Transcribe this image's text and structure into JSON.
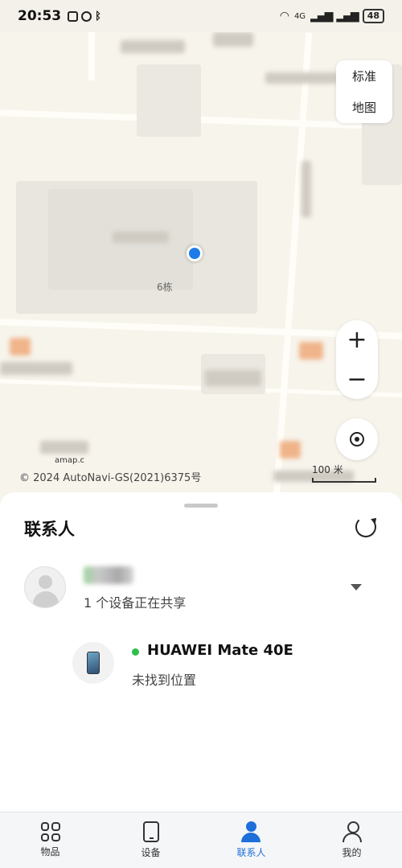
{
  "status_bar": {
    "time": "20:53",
    "battery": "48",
    "network": "4G"
  },
  "map": {
    "type_options": [
      "标准",
      "地图"
    ],
    "poi_label": "6栋",
    "attribution_logo": "amap.c",
    "copyright": "© 2024 AutoNavi-GS(2021)6375号",
    "scale": "100 米",
    "zoom_in": "+",
    "zoom_out": "−"
  },
  "sheet": {
    "title": "联系人",
    "contact": {
      "sharing_text": "1 个设备正在共享"
    },
    "device": {
      "name": "HUAWEI Mate 40E",
      "status": "未找到位置",
      "online_color": "#2fbf4a"
    }
  },
  "bottom_nav": {
    "items": [
      {
        "label": "物品",
        "icon": "grid-icon",
        "active": false
      },
      {
        "label": "设备",
        "icon": "tablet-icon",
        "active": false
      },
      {
        "label": "联系人",
        "icon": "people-icon",
        "active": true
      },
      {
        "label": "我的",
        "icon": "person-icon",
        "active": false
      }
    ],
    "active_color": "#1e6fd9"
  }
}
